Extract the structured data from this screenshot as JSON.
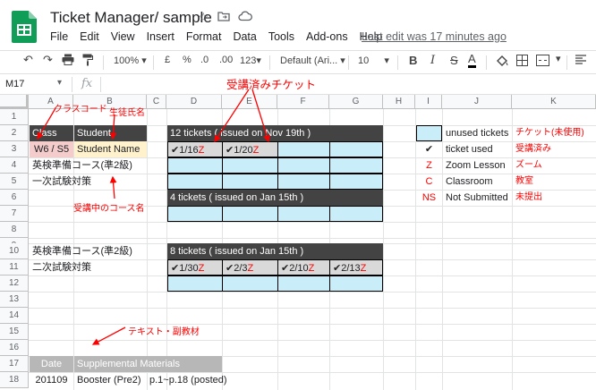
{
  "header": {
    "title": "Ticket Manager/ sample",
    "last_edit": "Last edit was 17 minutes ago",
    "menu": [
      "File",
      "Edit",
      "View",
      "Insert",
      "Format",
      "Data",
      "Tools",
      "Add-ons",
      "Help"
    ]
  },
  "toolbar": {
    "zoom": "100%",
    "currency": "£",
    "percent": "%",
    "dec_less": ".0",
    "dec_more": ".00",
    "more_formats": "123",
    "font": "Default (Ari...",
    "font_size": "10",
    "bold": "B",
    "italic": "I",
    "strike": "S",
    "text_color": "A"
  },
  "formula_bar": {
    "name_box": "M17",
    "fx": "fx"
  },
  "columns": [
    "A",
    "B",
    "C",
    "D",
    "E",
    "F",
    "G",
    "H",
    "I",
    "J",
    "K"
  ],
  "rows": [
    "1",
    "2",
    "3",
    "4",
    "5",
    "6",
    "7",
    "8",
    "9",
    "10",
    "11",
    "12",
    "13",
    "14",
    "15",
    "16",
    "17",
    "18"
  ],
  "cells": {
    "a2": "Class",
    "b2": "Student",
    "a3": "W6 / S5",
    "b3": "Student Name",
    "a4": "英検準備コース(準2級)",
    "a5": "一次試験対策",
    "a10": "英検準備コース(準2級)",
    "a11": "二次試験対策",
    "block1_title": "12 tickets ( issued on Nov 19th )",
    "block1_d3": "✔1/16",
    "block1_d3_mark": "Z",
    "block1_e3": "✔1/20",
    "block1_e3_mark": "Z",
    "block2_title": "4 tickets ( issued on Jan 15th )",
    "block3_title": "8 tickets ( issued on Jan 15th )",
    "block3_d11": "✔1/30",
    "block3_d11_mark": "Z",
    "block3_e11": "✔2/3",
    "block3_e11_mark": "Z",
    "block3_f11": "✔2/10",
    "block3_f11_mark": "Z",
    "block3_g11": "✔2/13",
    "block3_g11_mark": "Z",
    "a17": "Date",
    "b17": "Supplemental Materials",
    "a18": "201109",
    "b18": "Booster (Pre2)",
    "d18": "p.1~p.18 (posted)"
  },
  "legend": [
    {
      "symbol": "",
      "label": "unused tickets",
      "note": "チケット(未使用)"
    },
    {
      "symbol": "✔",
      "label": "ticket used",
      "note": "受講済み"
    },
    {
      "symbol": "Z",
      "label": "Zoom Lesson",
      "note": "ズーム"
    },
    {
      "symbol": "C",
      "label": "Classroom",
      "note": "教室"
    },
    {
      "symbol": "NS",
      "label": "Not Submitted",
      "note": "未提出"
    }
  ],
  "annotations": {
    "class_code": "クラスコード",
    "student_name": "生徒氏名",
    "used_tickets": "受講済みチケット",
    "course_name": "受講中のコース名",
    "materials": "テキスト・副教材"
  },
  "colors": {
    "accent": "#ff0000",
    "dark_header": "#434343",
    "ticket_blue": "#c9eef9",
    "sheets_green": "#0f9d58"
  }
}
